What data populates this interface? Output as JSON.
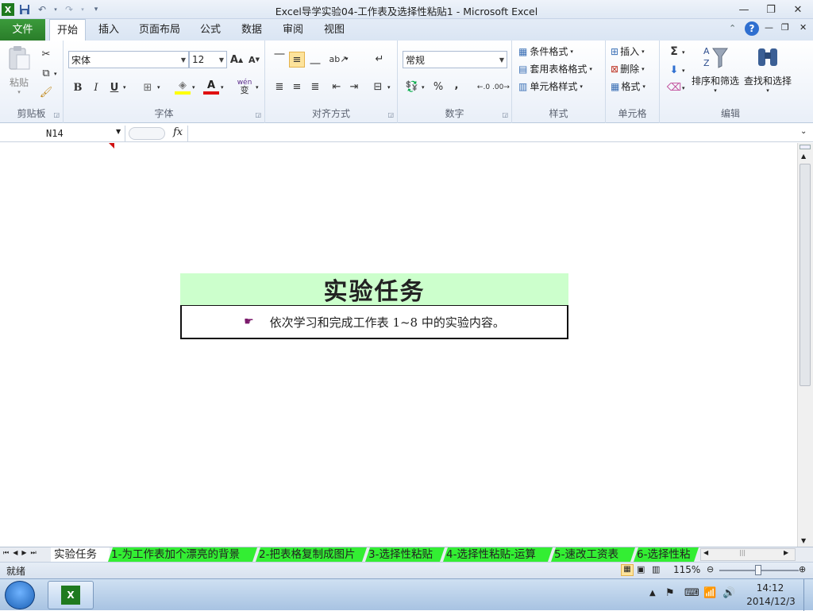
{
  "window": {
    "title": "Excel导学实验04-工作表及选择性粘贴1  -  Microsoft Excel"
  },
  "ribbon_tabs": [
    "文件",
    "开始",
    "插入",
    "页面布局",
    "公式",
    "数据",
    "审阅",
    "视图"
  ],
  "active_tab": "开始",
  "colors": {
    "file_tab": "#2a8a2a",
    "task_header_bg": "#ccffcc",
    "sheet_tab_green": "#33ee33"
  },
  "clipboard": {
    "paste_label": "粘贴",
    "group_label": "剪贴板"
  },
  "font": {
    "name": "宋体",
    "size": "12",
    "bold": "B",
    "italic": "I",
    "underline": "U",
    "font_color_glyph": "A",
    "grow_glyph": "A",
    "shrink_glyph": "A",
    "phonetic_glyph": "wén",
    "group_label": "字体"
  },
  "alignment": {
    "group_label": "对齐方式"
  },
  "number": {
    "format": "常规",
    "percent": "%",
    "comma": ",",
    "group_label": "数字"
  },
  "styles": {
    "conditional": "条件格式",
    "table": "套用表格格式",
    "cell": "单元格样式",
    "group_label": "样式"
  },
  "cells": {
    "insert": "插入",
    "delete": "删除",
    "format": "格式",
    "group_label": "单元格"
  },
  "editing": {
    "sigma": "Σ",
    "sort_filter": "排序和筛选",
    "find_select": "查找和选择",
    "group_label": "编辑"
  },
  "formula_bar": {
    "name_box": "N14",
    "fx": "fx",
    "formula": ""
  },
  "task": {
    "title": "实验任务",
    "instruction": "依次学习和完成工作表 1~8 中的实验内容。"
  },
  "sheet_tabs": [
    {
      "label": "实验任务",
      "active": true
    },
    {
      "label": "1-为工作表加个漂亮的背景",
      "active": false
    },
    {
      "label": "2-把表格复制成图片",
      "active": false
    },
    {
      "label": "3-选择性粘贴",
      "active": false
    },
    {
      "label": "4-选择性粘贴-运算",
      "active": false
    },
    {
      "label": "5-速改工资表",
      "active": false
    },
    {
      "label": "6-选择性粘",
      "active": false
    }
  ],
  "status": {
    "ready": "就绪",
    "zoom": "115%",
    "zoom_fraction": 0.5
  },
  "taskbar": {
    "time": "14:12",
    "date": "2014/12/3"
  }
}
